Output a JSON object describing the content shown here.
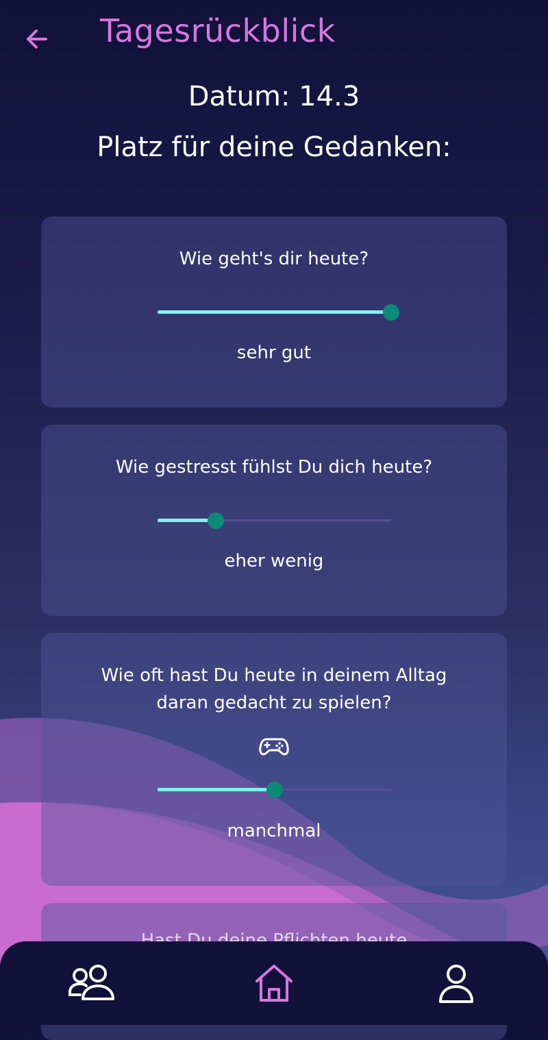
{
  "header": {
    "title": "Tagesrückblick",
    "back_icon": "arrow-left-icon"
  },
  "date_label": "Datum: 14.3",
  "subtitle": "Platz für deine Gedanken:",
  "colors": {
    "accent": "#d678dc",
    "slider_active": "#7ff3ea",
    "slider_inactive": "#5b4b9a",
    "slider_thumb": "#0e8a78",
    "nav_background": "#11113a"
  },
  "cards": [
    {
      "question": "Wie geht's dir heute?",
      "slider_value": 1.0,
      "answer": "sehr gut"
    },
    {
      "question": "Wie gestresst fühlst Du dich heute?",
      "slider_value": 0.25,
      "answer": "eher wenig"
    },
    {
      "question_line1": "Wie oft hast Du heute in deinem Alltag",
      "question_line2": "daran gedacht zu spielen?",
      "icon": "gamepad-icon",
      "slider_value": 0.5,
      "answer": "manchmal"
    },
    {
      "question": "Hast Du deine Pflichten heute"
    }
  ],
  "bottom_nav": {
    "items": [
      {
        "icon": "community-icon"
      },
      {
        "icon": "home-icon",
        "active": true
      },
      {
        "icon": "profile-icon"
      }
    ]
  }
}
